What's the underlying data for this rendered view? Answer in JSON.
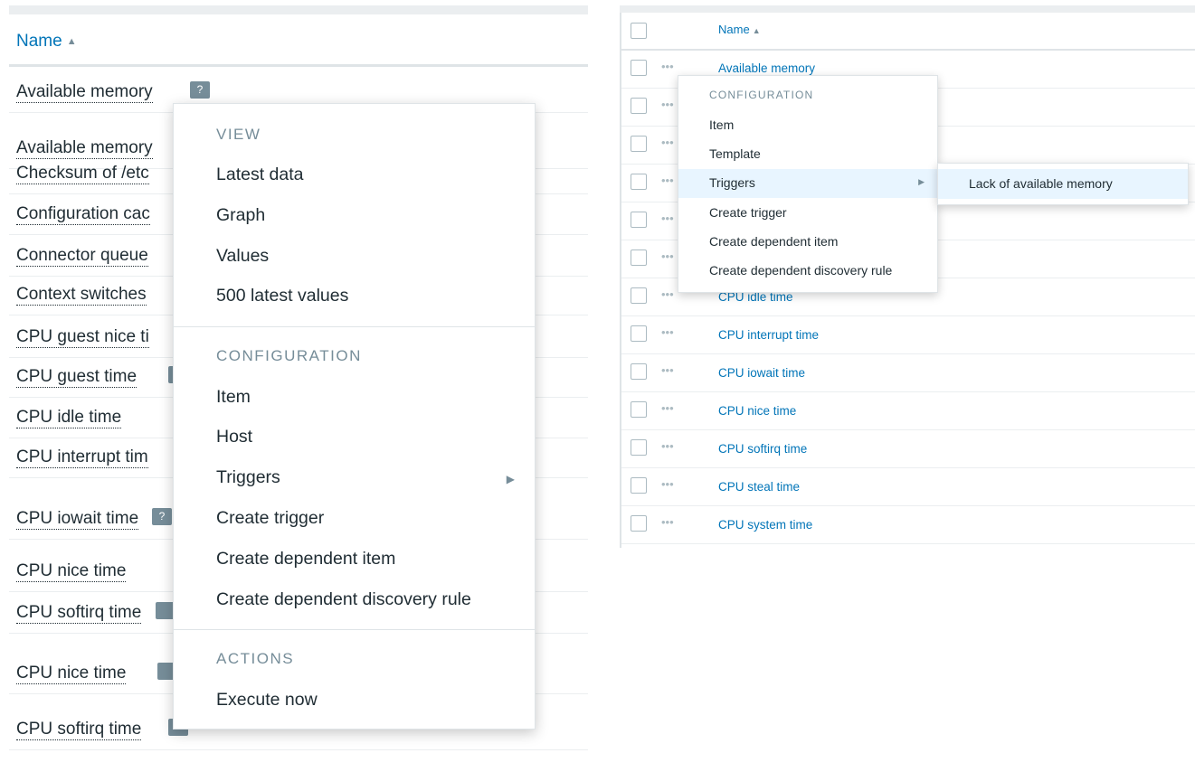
{
  "left": {
    "column_header": "Name",
    "sort_arrow": "▲",
    "rows": [
      "Available memory",
      "Available memory",
      "Checksum of /etc",
      "Configuration cac",
      "Connector queue",
      "Context switches",
      "CPU guest nice ti",
      "CPU guest time",
      "CPU idle time",
      "CPU interrupt tim",
      "CPU iowait time",
      "CPU nice time",
      "CPU softirq time"
    ],
    "hint_icon_glyph": "?",
    "menu": {
      "view_title": "VIEW",
      "view_items": [
        "Latest data",
        "Graph",
        "Values",
        "500 latest values"
      ],
      "config_title": "CONFIGURATION",
      "config_items": [
        "Item",
        "Host",
        "Triggers",
        "Create trigger",
        "Create dependent item",
        "Create dependent discovery rule"
      ],
      "actions_title": "ACTIONS",
      "actions_items": [
        "Execute now"
      ],
      "submenu_arrow": "▶"
    }
  },
  "right": {
    "column_header": "Name",
    "sort_arrow": "▲",
    "dots": "•••",
    "rows": [
      "Available memory",
      "",
      "",
      "",
      "",
      "",
      "CPU idle time",
      "CPU interrupt time",
      "CPU iowait time",
      "CPU nice time",
      "CPU softirq time",
      "CPU steal time",
      "CPU system time"
    ],
    "menu": {
      "config_title": "CONFIGURATION",
      "items": [
        "Item",
        "Template",
        "Triggers",
        "Create trigger",
        "Create dependent item",
        "Create dependent discovery rule"
      ],
      "submenu_arrow": "▶"
    },
    "submenu": {
      "items": [
        "Lack of available memory"
      ]
    }
  },
  "colors": {
    "link": "#0275b8",
    "muted": "#768d99",
    "highlight": "#e8f5ff",
    "border": "#dfe4e7"
  }
}
